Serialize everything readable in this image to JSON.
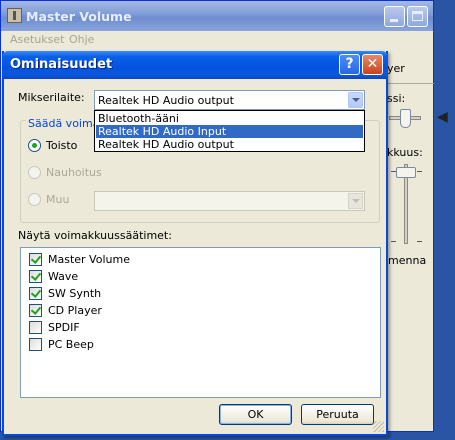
{
  "background_window": {
    "title": "Master Volume",
    "menu": [
      "Asetukset",
      "Ohje"
    ],
    "partial_labels": {
      "balance_label_fragment": "yer",
      "tasapaino_fragment": "ssi:",
      "volume_fragment": "kkuus:",
      "mute_fragment": "imenna"
    }
  },
  "dialog": {
    "title": "Ominaisuudet",
    "help_glyph": "?",
    "close_glyph": "✕",
    "mixer_label": "Mikserilaite:",
    "mixer_value": "Realtek HD Audio output",
    "mixer_options": [
      "Bluetooth-ääni",
      "Realtek HD Audio Input",
      "Realtek HD Audio output"
    ],
    "mixer_highlighted_index": 1,
    "adjust_group_title": "Säädä voima",
    "radios": [
      {
        "label": "Toisto",
        "checked": true,
        "enabled": true
      },
      {
        "label": "Nauhoitus",
        "checked": false,
        "enabled": false
      },
      {
        "label": "Muu",
        "checked": false,
        "enabled": false
      }
    ],
    "controls_label": "Näytä voimakkuussäätimet:",
    "controls": [
      {
        "label": "Master Volume",
        "checked": true
      },
      {
        "label": "Wave",
        "checked": true
      },
      {
        "label": "SW Synth",
        "checked": true
      },
      {
        "label": "CD Player",
        "checked": true
      },
      {
        "label": "SPDIF",
        "checked": false
      },
      {
        "label": "PC Beep",
        "checked": false
      }
    ],
    "ok_label": "OK",
    "cancel_label": "Peruuta"
  }
}
